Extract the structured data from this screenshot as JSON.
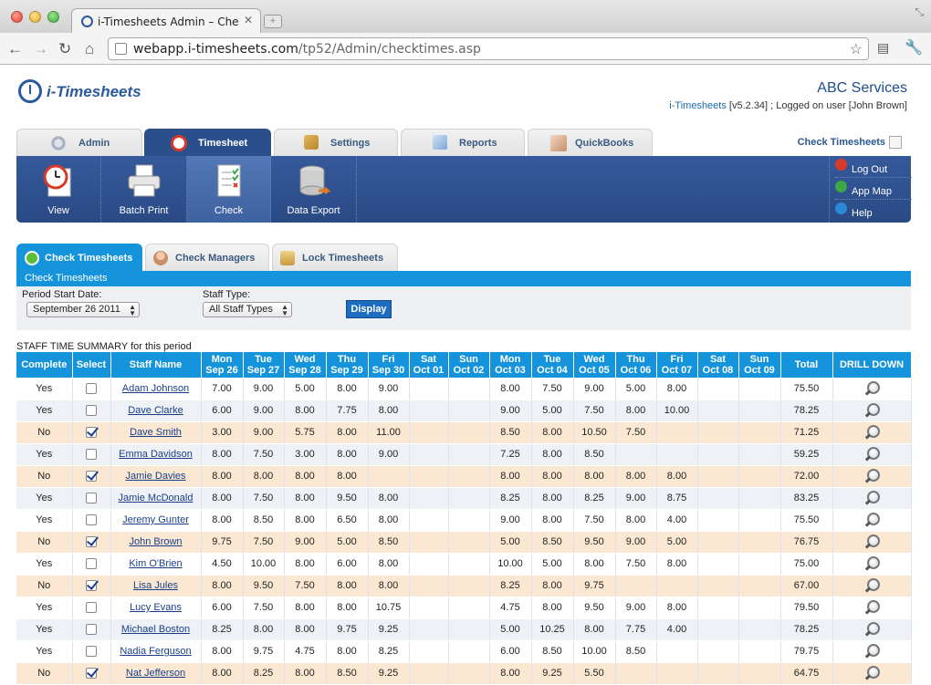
{
  "browser": {
    "tab_title": "i-Timesheets Admin – Check",
    "tab_close": "✕",
    "url_host": "webapp.i-timesheets.com",
    "url_path": "/tp52/Admin/checktimes.asp"
  },
  "header": {
    "logo_text": "i-Timesheets",
    "company": "ABC Services",
    "version_link": "i-Timesheets",
    "version_rest": " [v5.2.34] ; Logged on user [John Brown]"
  },
  "main_tabs": [
    {
      "label": "Admin",
      "icon": "gear-icon"
    },
    {
      "label": "Timesheet",
      "icon": "clock-icon"
    },
    {
      "label": "Settings",
      "icon": "wrench-icon"
    },
    {
      "label": "Reports",
      "icon": "report-icon"
    },
    {
      "label": "QuickBooks",
      "icon": "quickbooks-icon"
    }
  ],
  "check_timesheets_link": "Check Timesheets",
  "tools": [
    {
      "label": "View",
      "icon": "clock-document-icon"
    },
    {
      "label": "Batch Print",
      "icon": "printer-icon"
    },
    {
      "label": "Check",
      "icon": "checklist-icon"
    },
    {
      "label": "Data Export",
      "icon": "database-export-icon"
    }
  ],
  "side_links": [
    {
      "label": "Log Out",
      "icon": "logout-icon",
      "color": "#d83a2a"
    },
    {
      "label": "App Map",
      "icon": "appmap-icon",
      "color": "#3aa845"
    },
    {
      "label": "Help",
      "icon": "help-icon",
      "color": "#2a8ad8"
    }
  ],
  "sub_tabs": [
    {
      "label": "Check Timesheets",
      "icon": "check-circle-icon"
    },
    {
      "label": "Check Managers",
      "icon": "manager-icon"
    },
    {
      "label": "Lock Timesheets",
      "icon": "lock-icon"
    }
  ],
  "panel": {
    "title": "Check Timesheets",
    "period_label": "Period Start Date:",
    "period_value": "September 26 2011",
    "staff_type_label": "Staff Type:",
    "staff_type_value": "All Staff Types",
    "display_button": "Display"
  },
  "summary_label": "STAFF TIME SUMMARY for this period",
  "table": {
    "headers": [
      [
        "Complete",
        ""
      ],
      [
        "Select",
        ""
      ],
      [
        "Staff Name",
        ""
      ],
      [
        "Mon",
        "Sep 26"
      ],
      [
        "Tue",
        "Sep 27"
      ],
      [
        "Wed",
        "Sep 28"
      ],
      [
        "Thu",
        "Sep 29"
      ],
      [
        "Fri",
        "Sep 30"
      ],
      [
        "Sat",
        "Oct 01"
      ],
      [
        "Sun",
        "Oct 02"
      ],
      [
        "Mon",
        "Oct 03"
      ],
      [
        "Tue",
        "Oct 04"
      ],
      [
        "Wed",
        "Oct 05"
      ],
      [
        "Thu",
        "Oct 06"
      ],
      [
        "Fri",
        "Oct 07"
      ],
      [
        "Sat",
        "Oct 08"
      ],
      [
        "Sun",
        "Oct 09"
      ],
      [
        "Total",
        ""
      ],
      [
        "DRILL DOWN",
        ""
      ]
    ],
    "rows": [
      {
        "complete": "Yes",
        "selected": false,
        "name": "Adam Johnson",
        "hours": [
          "7.00",
          "9.00",
          "5.00",
          "8.00",
          "9.00",
          "",
          "",
          "8.00",
          "7.50",
          "9.00",
          "5.00",
          "8.00",
          "",
          ""
        ],
        "total": "75.50"
      },
      {
        "complete": "Yes",
        "selected": false,
        "name": "Dave Clarke",
        "hours": [
          "6.00",
          "9.00",
          "8.00",
          "7.75",
          "8.00",
          "",
          "",
          "9.00",
          "5.00",
          "7.50",
          "8.00",
          "10.00",
          "",
          ""
        ],
        "total": "78.25"
      },
      {
        "complete": "No",
        "selected": true,
        "name": "Dave Smith",
        "hours": [
          "3.00",
          "9.00",
          "5.75",
          "8.00",
          "11.00",
          "",
          "",
          "8.50",
          "8.00",
          "10.50",
          "7.50",
          "",
          "",
          ""
        ],
        "total": "71.25"
      },
      {
        "complete": "Yes",
        "selected": false,
        "name": "Emma Davidson",
        "hours": [
          "8.00",
          "7.50",
          "3.00",
          "8.00",
          "9.00",
          "",
          "",
          "7.25",
          "8.00",
          "8.50",
          "",
          "",
          "",
          ""
        ],
        "total": "59.25"
      },
      {
        "complete": "No",
        "selected": true,
        "name": "Jamie Davies",
        "hours": [
          "8.00",
          "8.00",
          "8.00",
          "8.00",
          "",
          "",
          "",
          "8.00",
          "8.00",
          "8.00",
          "8.00",
          "8.00",
          "",
          ""
        ],
        "total": "72.00"
      },
      {
        "complete": "Yes",
        "selected": false,
        "name": "Jamie McDonald",
        "hours": [
          "8.00",
          "7.50",
          "8.00",
          "9.50",
          "8.00",
          "",
          "",
          "8.25",
          "8.00",
          "8.25",
          "9.00",
          "8.75",
          "",
          ""
        ],
        "total": "83.25"
      },
      {
        "complete": "Yes",
        "selected": false,
        "name": "Jeremy Gunter",
        "hours": [
          "8.00",
          "8.50",
          "8.00",
          "6.50",
          "8.00",
          "",
          "",
          "9.00",
          "8.00",
          "7.50",
          "8.00",
          "4.00",
          "",
          ""
        ],
        "total": "75.50"
      },
      {
        "complete": "No",
        "selected": true,
        "name": "John Brown",
        "hours": [
          "9.75",
          "7.50",
          "9.00",
          "5.00",
          "8.50",
          "",
          "",
          "5.00",
          "8.50",
          "9.50",
          "9.00",
          "5.00",
          "",
          ""
        ],
        "total": "76.75"
      },
      {
        "complete": "Yes",
        "selected": false,
        "name": "Kim O'Brien",
        "hours": [
          "4.50",
          "10.00",
          "8.00",
          "6.00",
          "8.00",
          "",
          "",
          "10.00",
          "5.00",
          "8.00",
          "7.50",
          "8.00",
          "",
          ""
        ],
        "total": "75.00"
      },
      {
        "complete": "No",
        "selected": true,
        "name": "Lisa Jules",
        "hours": [
          "8.00",
          "9.50",
          "7.50",
          "8.00",
          "8.00",
          "",
          "",
          "8.25",
          "8.00",
          "9.75",
          "",
          "",
          "",
          ""
        ],
        "total": "67.00"
      },
      {
        "complete": "Yes",
        "selected": false,
        "name": "Lucy Evans",
        "hours": [
          "6.00",
          "7.50",
          "8.00",
          "8.00",
          "10.75",
          "",
          "",
          "4.75",
          "8.00",
          "9.50",
          "9.00",
          "8.00",
          "",
          ""
        ],
        "total": "79.50"
      },
      {
        "complete": "Yes",
        "selected": false,
        "name": "Michael Boston",
        "hours": [
          "8.25",
          "8.00",
          "8.00",
          "9.75",
          "9.25",
          "",
          "",
          "5.00",
          "10.25",
          "8.00",
          "7.75",
          "4.00",
          "",
          ""
        ],
        "total": "78.25"
      },
      {
        "complete": "Yes",
        "selected": false,
        "name": "Nadia Ferguson",
        "hours": [
          "8.00",
          "9.75",
          "4.75",
          "8.00",
          "8.25",
          "",
          "",
          "6.00",
          "8.50",
          "10.00",
          "8.50",
          "",
          "",
          ""
        ],
        "total": "79.75"
      },
      {
        "complete": "No",
        "selected": true,
        "name": "Nat Jefferson",
        "hours": [
          "8.00",
          "8.25",
          "8.00",
          "8.50",
          "9.25",
          "",
          "",
          "8.00",
          "9.25",
          "5.50",
          "",
          "",
          "",
          ""
        ],
        "total": "64.75"
      }
    ]
  }
}
